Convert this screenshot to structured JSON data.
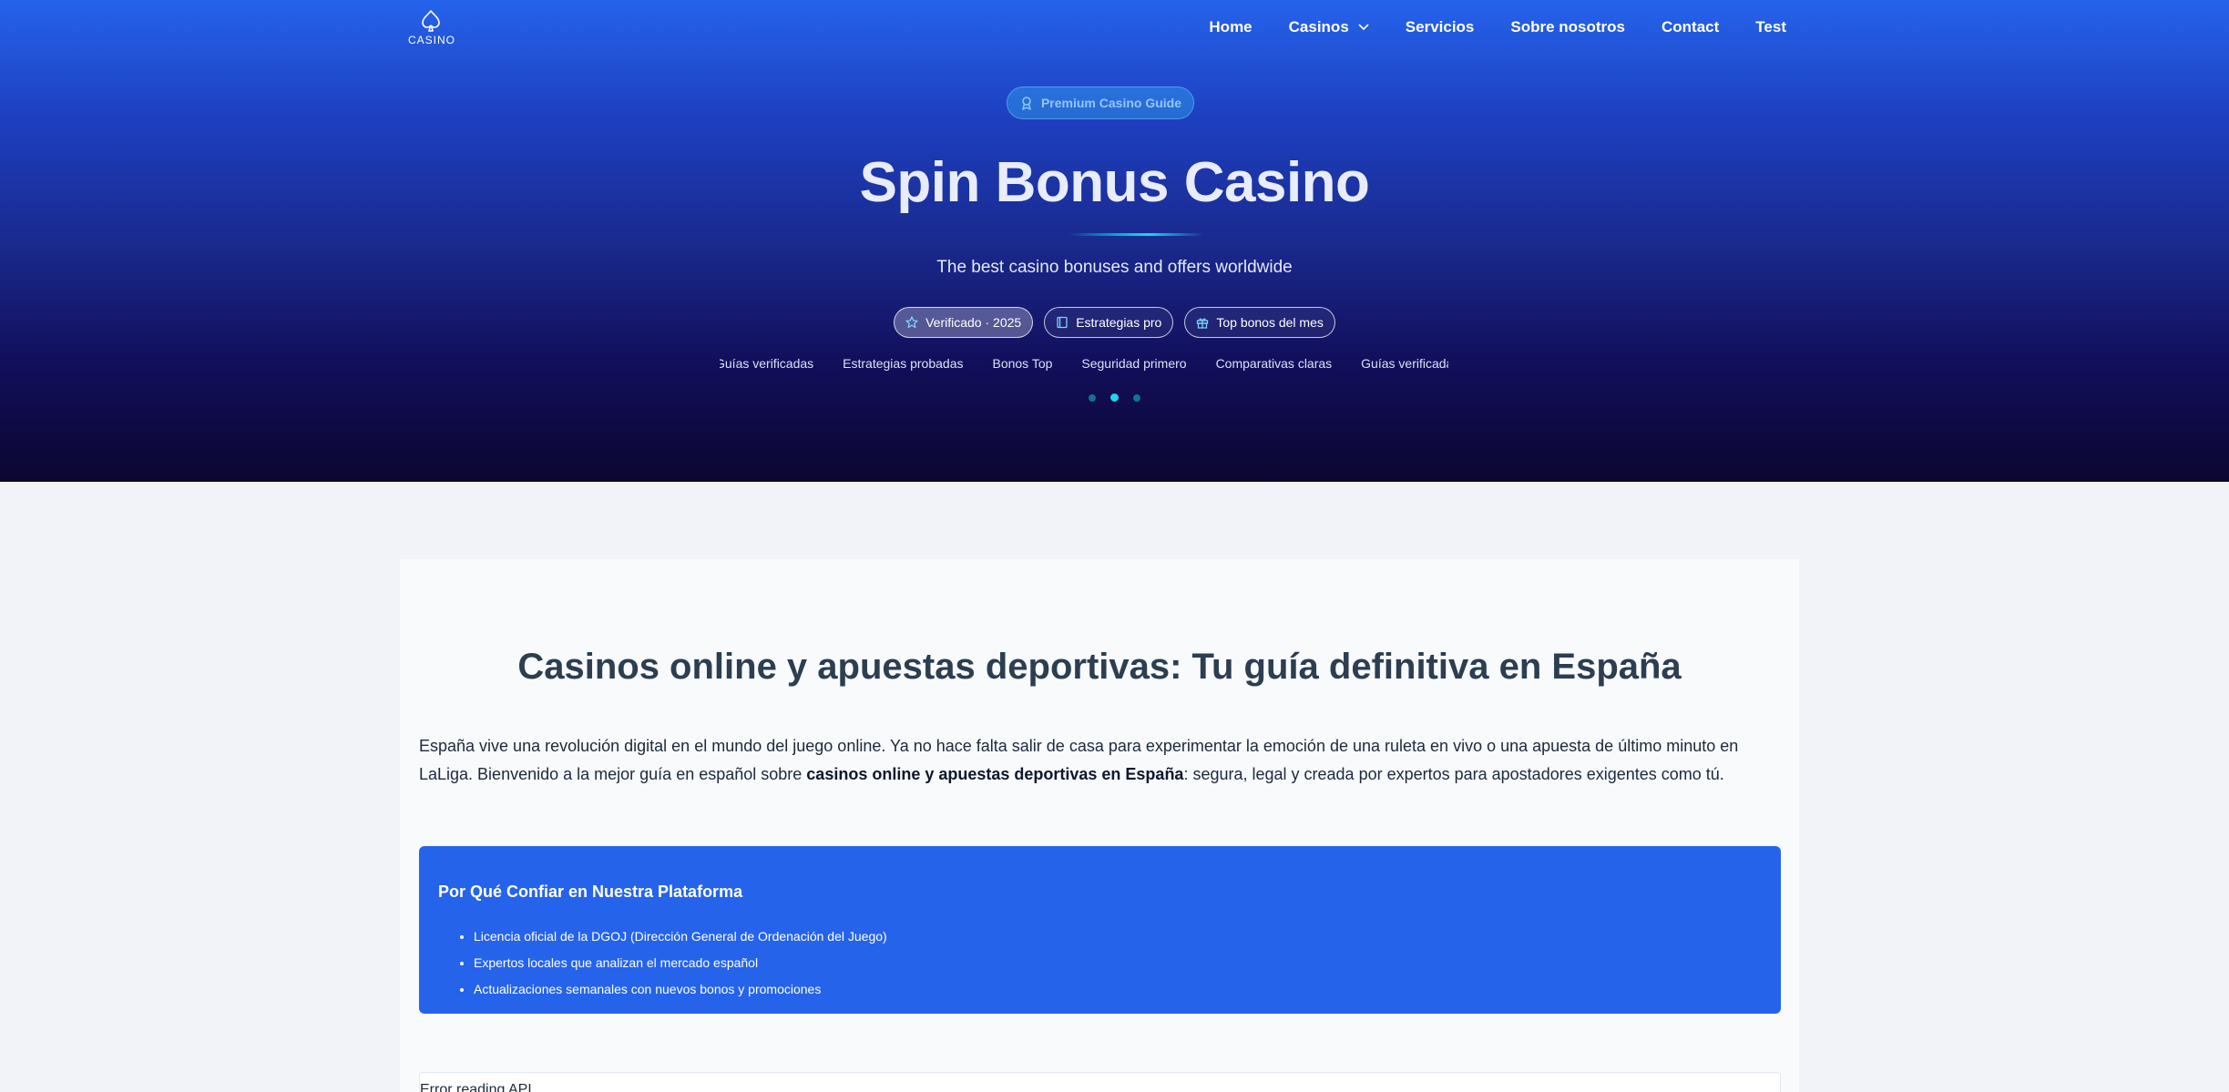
{
  "nav": {
    "logo_text": "CASINO",
    "items": [
      {
        "label": "Home"
      },
      {
        "label": "Casinos"
      },
      {
        "label": "Servicios"
      },
      {
        "label": "Sobre nosotros"
      },
      {
        "label": "Contact"
      },
      {
        "label": "Test"
      }
    ]
  },
  "hero": {
    "pill_label": "Premium Casino Guide",
    "title": "Spin Bonus Casino",
    "subtitle": "The best casino bonuses and offers worldwide",
    "tags": [
      {
        "label": "Verificado · 2025",
        "icon": "star-icon"
      },
      {
        "label": "Estrategias pro",
        "icon": "book-icon"
      },
      {
        "label": "Top bonos del mes",
        "icon": "gift-icon"
      }
    ],
    "ticker": [
      "Guías verificadas",
      "Estrategias probadas",
      "Bonos Top",
      "Seguridad primero",
      "Comparativas claras",
      "Guías verificadas"
    ],
    "carousel_active_index": 1
  },
  "content": {
    "title": "Casinos online y apuestas deportivas: Tu guía definitiva en España",
    "intro_before": "España vive una revolución digital en el mundo del juego online. Ya no hace falta salir de casa para experimentar la emoción de una ruleta en vivo o una apuesta de último minuto en LaLiga. Bienvenido a la mejor guía en español sobre ",
    "intro_bold": "casinos online y apuestas deportivas en España",
    "intro_after": ": segura, legal y creada por expertos para apostadores exigentes como tú.",
    "trust": {
      "heading": "Por Qué Confiar en Nuestra Plataforma",
      "items": [
        "Licencia oficial de la DGOJ (Dirección General de Ordenación del Juego)",
        "Expertos locales que analizan el mercado español",
        "Actualizaciones semanales con nuevos bonos y promociones"
      ]
    },
    "api_error": "Error reading API"
  },
  "colors": {
    "primary": "#2563eb",
    "hero_bottom": "#0b0630",
    "accent": "#22d3ee",
    "heading": "#2c3e50"
  }
}
